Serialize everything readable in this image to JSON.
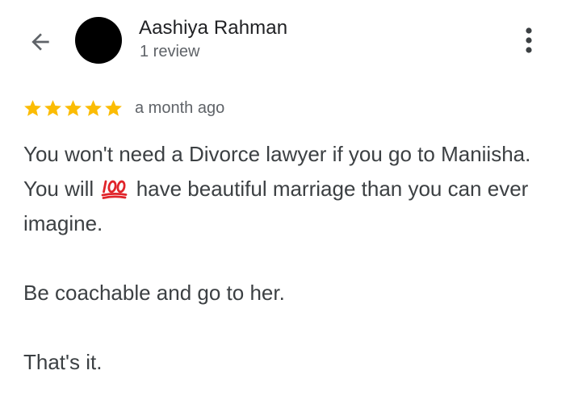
{
  "header": {
    "back_icon": "arrow-left-icon",
    "more_icon": "more-vert-icon",
    "avatar_color": "#000000"
  },
  "reviewer": {
    "name": "Aashiya Rahman",
    "review_count": "1 review"
  },
  "review": {
    "rating": 5,
    "max_rating": 5,
    "star_color": "#fbbc04",
    "time": "a month ago",
    "line1_before": "You won't need a Divorce lawyer if you go to Maniisha. You will",
    "emoji": "💯",
    "emoji_name": "hundred-points-emoji",
    "line1_after": "have beautiful marriage than you can ever imagine.",
    "paragraph2": "Be coachable and go to her.",
    "paragraph3": "That's it."
  }
}
